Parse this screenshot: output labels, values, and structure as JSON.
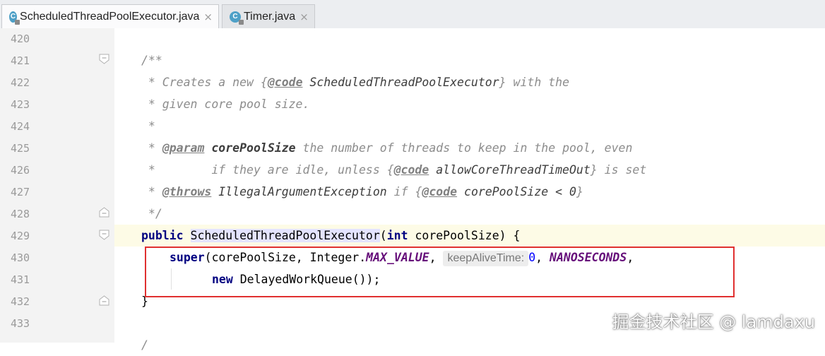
{
  "tabs": [
    {
      "label": "ScheduledThreadPoolExecutor.java",
      "icon": "java-class-icon",
      "active": true,
      "close": "×"
    },
    {
      "label": "Timer.java",
      "icon": "java-class-icon",
      "active": false,
      "close": "×"
    }
  ],
  "tab_icon_letter": "C",
  "line_numbers": [
    "420",
    "421",
    "422",
    "423",
    "424",
    "425",
    "426",
    "427",
    "428",
    "429",
    "430",
    "431",
    "432",
    "433"
  ],
  "code": {
    "l421": "/**",
    "l422": {
      "a": " * Creates a new ",
      "b": "{",
      "tag": "@code",
      "c": " ScheduledThreadPoolExecutor",
      "d": "}",
      "e": " with the"
    },
    "l423": " * given core pool size.",
    "l424": " *",
    "l425": {
      "a": " * ",
      "tag": "@param",
      "sp": " ",
      "pn": "corePoolSize",
      "rest": " the number of threads to keep in the pool, even"
    },
    "l426": {
      "a": " *        if they are idle, unless ",
      "b": "{",
      "tag": "@code",
      "c": " allowCoreThreadTimeOut",
      "d": "}",
      "e": " is set"
    },
    "l427": {
      "a": " * ",
      "tag": "@throws",
      "sp": " ",
      "ex": "IllegalArgumentException",
      "b": " if ",
      "br": "{",
      "tag2": "@code",
      "c": " corePoolSize < 0",
      "d": "}"
    },
    "l428": " */",
    "l429": {
      "kw1": "public",
      "sp": " ",
      "name": "ScheduledThreadPoolExecutor",
      "p1": "(",
      "kw2": "int",
      "rest": " corePoolSize) {"
    },
    "l430": {
      "kw": "super",
      "a": "(corePoolSize, Integer.",
      "f1": "MAX_VALUE",
      "comma": ", ",
      "hint": "keepAliveTime:",
      "num": "0",
      "comma2": ", ",
      "f2": "NANOSECONDS",
      "end": ","
    },
    "l431": {
      "kw": "new",
      "rest": " DelayedWorkQueue());"
    },
    "l432": "}",
    "l433": "/"
  },
  "watermark": "掘金技术社区 @ lamdaxu",
  "colors": {
    "highlight_box": "#e03030",
    "keyword": "#000080",
    "field": "#660e7a",
    "comment": "#8c8c8c"
  }
}
